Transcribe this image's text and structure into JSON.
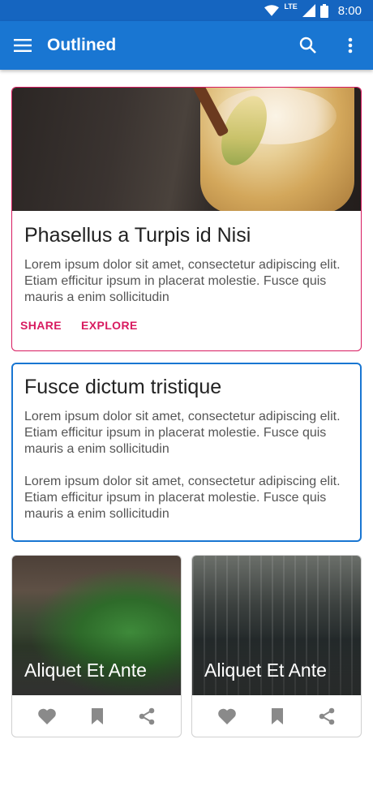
{
  "status": {
    "time": "8:00",
    "network": "LTE"
  },
  "appbar": {
    "title": "Outlined"
  },
  "cards": [
    {
      "title": "Phasellus a Turpis id Nisi",
      "body": "Lorem ipsum dolor sit amet, consectetur adipiscing elit. Etiam efficitur ipsum in placerat molestie.  Fusce quis mauris a enim sollicitudin",
      "actions": {
        "share": "SHARE",
        "explore": "EXPLORE"
      }
    },
    {
      "title": "Fusce dictum tristique",
      "body1": "Lorem ipsum dolor sit amet, consectetur adipiscing elit. Etiam efficitur ipsum in placerat molestie.  Fusce quis mauris a enim sollicitudin",
      "body2": "Lorem ipsum dolor sit amet, consectetur adipiscing elit. Etiam efficitur ipsum in placerat molestie.  Fusce quis mauris a enim sollicitudin"
    }
  ],
  "grid": [
    {
      "title": "Aliquet Et Ante"
    },
    {
      "title": "Aliquet Et Ante"
    }
  ],
  "colors": {
    "primary": "#1976d2",
    "status": "#1565c0",
    "accent": "#d81b60",
    "icon": "#8a8a8a"
  },
  "icons": [
    "menu-icon",
    "search-icon",
    "more-vert-icon",
    "favorite-icon",
    "bookmark-icon",
    "share-icon"
  ]
}
